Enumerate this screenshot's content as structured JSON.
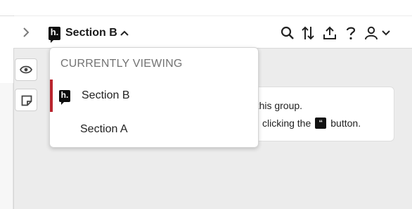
{
  "header": {
    "current_group": "Section B",
    "logo_letter": "h."
  },
  "dropdown": {
    "heading": "CURRENTLY VIEWING",
    "items": [
      {
        "label": "Section B",
        "selected": true
      },
      {
        "label": "Section A",
        "selected": false
      }
    ]
  },
  "card": {
    "line1": "n this group.",
    "line2_prefix": "clicking the",
    "line2_icon": "“",
    "line2_suffix": "button."
  },
  "icons": {
    "expand": "chevron-right-icon",
    "caret": "chevron-up-icon",
    "search": "search-icon",
    "sort": "sort-icon",
    "share": "share-icon",
    "help": "help-icon",
    "user": "user-icon",
    "menu_caret": "chevron-down-icon",
    "eye": "eye-icon",
    "note": "note-icon"
  },
  "colors": {
    "selected_accent": "#b9252e",
    "sidebar_bg": "#ececec"
  }
}
